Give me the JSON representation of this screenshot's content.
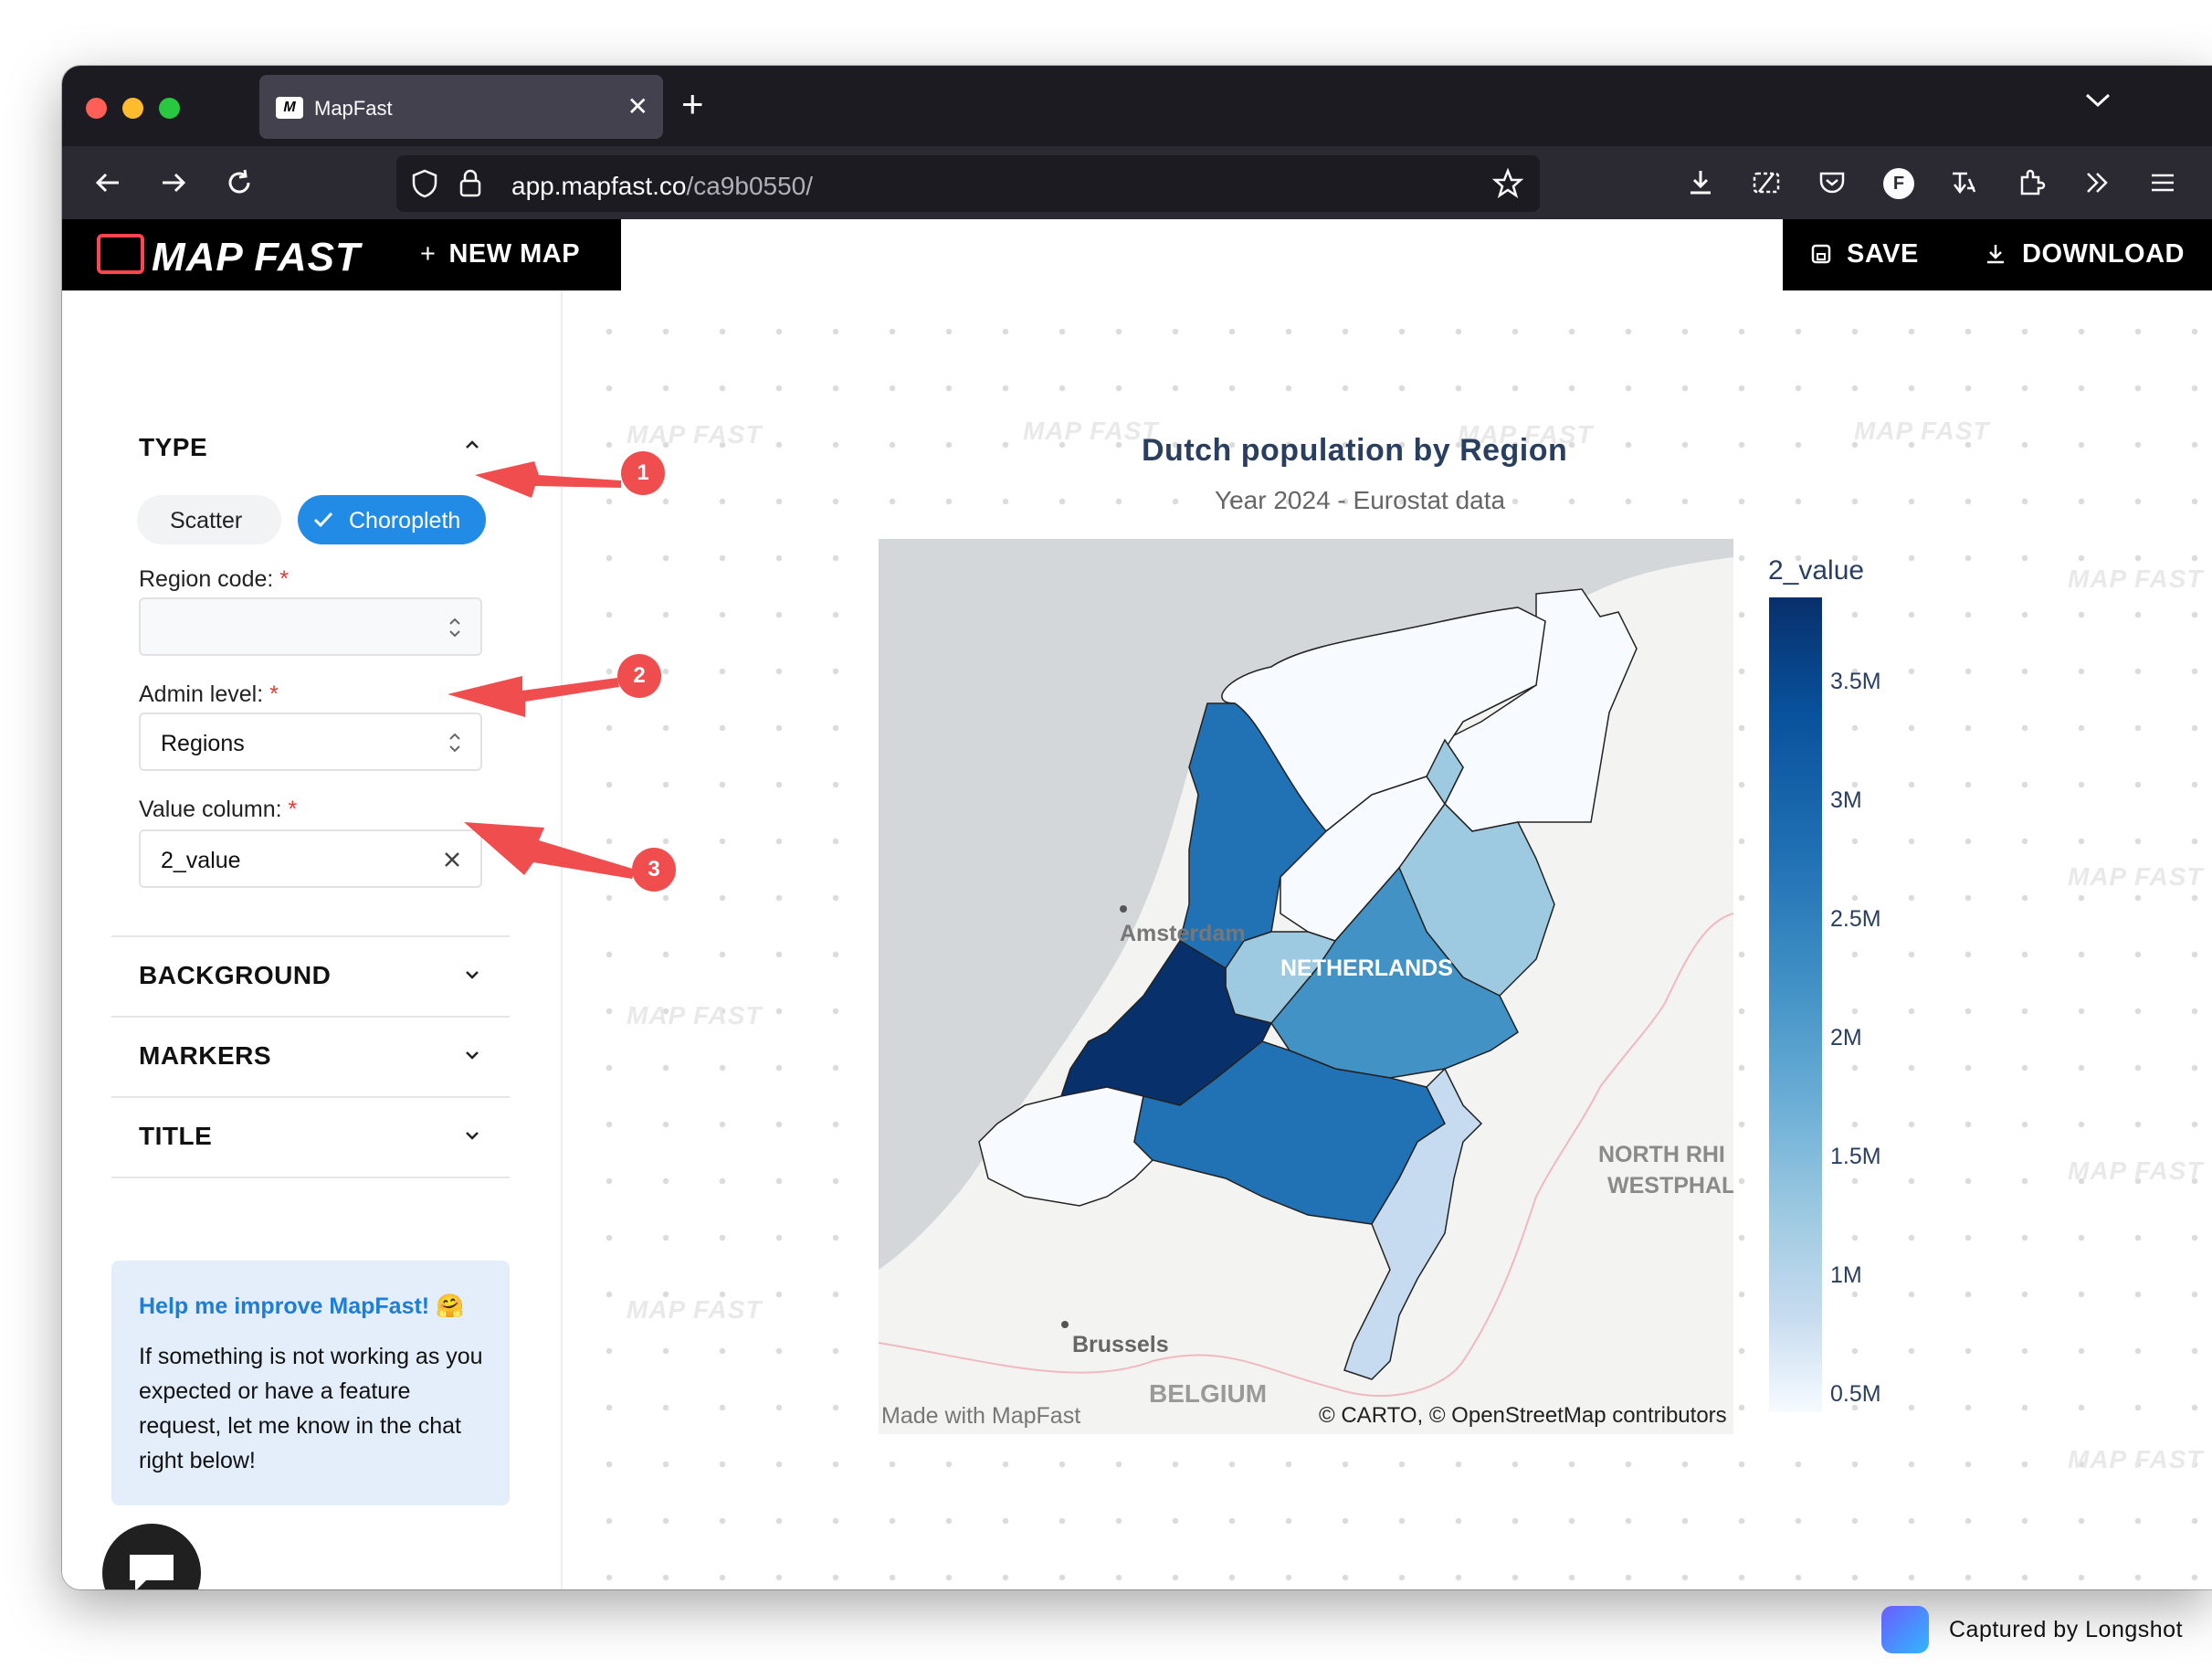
{
  "browser": {
    "tab_title": "MapFast",
    "favicon_text": "M",
    "url_domain": "app.mapfast.co",
    "url_path": "/ca9b0550/",
    "profile_letter": "F"
  },
  "app": {
    "logo_text": "MAP FAST",
    "new_map_label": "NEW MAP",
    "save_label": "SAVE",
    "download_label": "DOWNLOAD"
  },
  "sidebar": {
    "type_title": "TYPE",
    "type_options": [
      "Scatter",
      "Choropleth"
    ],
    "region_code_label": "Region code:",
    "region_code_value": "",
    "admin_level_label": "Admin level:",
    "admin_level_value": "Regions",
    "value_column_label": "Value column:",
    "value_column_value": "2_value",
    "required_mark": "*",
    "sections": [
      "BACKGROUND",
      "MARKERS",
      "TITLE"
    ],
    "help_title": "Help me improve MapFast! 🤗",
    "help_text": "If something is not working as you expected or have a feature request, let me know in the chat right below!"
  },
  "canvas": {
    "watermark": "MAP FAST",
    "title": "Dutch population by Region",
    "subtitle": "Year 2024 - Eurostat data",
    "made_with": "Made with MapFast",
    "attribution": "© CARTO, © OpenStreetMap contributors",
    "place_labels": [
      "Amsterdam",
      "NETHERLANDS",
      "NORTH RHI",
      "WESTPHAL",
      "Brussels",
      "BELGIUM"
    ]
  },
  "chart_data": {
    "type": "heatmap",
    "title": "Dutch population by Region",
    "subtitle": "Year 2024 - Eurostat data",
    "colorbar_title": "2_value",
    "colorbar_ticks": [
      "3.5M",
      "3M",
      "2.5M",
      "2M",
      "1.5M",
      "1M",
      "0.5M"
    ],
    "colorscale": [
      "#f7fbff",
      "#c6dbef",
      "#9ecae1",
      "#6baed6",
      "#4292c6",
      "#2171b5",
      "#08519c",
      "#08306b"
    ],
    "regions": [
      {
        "value": 0.6
      },
      {
        "value": 0.5
      },
      {
        "value": 0.5
      },
      {
        "value": 2.9
      },
      {
        "value": 0.4
      },
      {
        "value": 1.2
      },
      {
        "value": 2.1
      },
      {
        "value": 1.4
      },
      {
        "value": 3.8
      },
      {
        "value": 0.4
      },
      {
        "value": 2.6
      },
      {
        "value": 1.1
      }
    ]
  },
  "annotations": [
    "1",
    "2",
    "3"
  ],
  "footer": {
    "captured_by": "Captured by Longshot"
  }
}
